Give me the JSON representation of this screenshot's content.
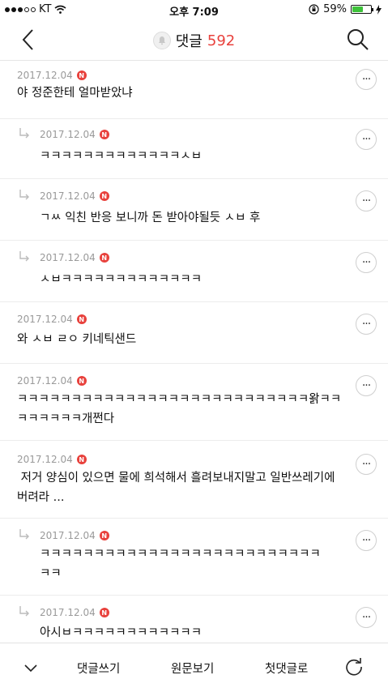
{
  "status_bar": {
    "carrier": "KT",
    "time": "오후 7:09",
    "battery": "59%",
    "battery_level": 0.59
  },
  "header": {
    "title": "댓글",
    "count": "592"
  },
  "comments": [
    {
      "date": "2017.12.04",
      "badge": "N",
      "text": "야 정준한테 얼마받았냐",
      "reply": false
    },
    {
      "date": "2017.12.04",
      "badge": "N",
      "text": "ㅋㅋㅋㅋㅋㅋㅋㅋㅋㅋㅋㅋㅋㅅㅂ",
      "reply": true
    },
    {
      "date": "2017.12.04",
      "badge": "N",
      "text": "ㄱㅆ 익친 반응 보니까 돈 받아야될듯 ㅅㅂ 후",
      "reply": true
    },
    {
      "date": "2017.12.04",
      "badge": "N",
      "text": "ㅅㅂㅋㅋㅋㅋㅋㅋㅋㅋㅋㅋㅋㅋㅋ",
      "reply": true
    },
    {
      "date": "2017.12.04",
      "badge": "N",
      "text": "와 ㅅㅂ ㄹㅇ 키네틱샌드",
      "reply": false
    },
    {
      "date": "2017.12.04",
      "badge": "N",
      "text_line1": "ㅋㅋㅋㅋㅋㅋㅋㅋㅋㅋㅋㅋㅋㅋㅋㅋㅋㅋㅋㅋㅋㅋㅋㅋㅋㅋㅋ왉ㅋㅋ",
      "text_line2": "ㅋㅋㅋㅋㅋㅋ개쩐다",
      "reply": false
    },
    {
      "date": "2017.12.04",
      "badge": "N",
      "text_line1": " 저거 양심이 있으면 물에 희석해서 흘려보내지말고 일반쓰레기에",
      "text_line2": "버려라 ...",
      "reply": false
    },
    {
      "date": "2017.12.04",
      "badge": "N",
      "text_line1": "ㅋㅋㅋㅋㅋㅋㅋㅋㅋㅋㅋㅋㅋㅋㅋㅋㅋㅋㅋㅋㅋㅋㅋㅋㅋㅋ",
      "text_line2": "ㅋㅋ",
      "reply": true
    },
    {
      "date": "2017.12.04",
      "badge": "N",
      "text": "아시ㅂㅋㅋㅋㅋㅋㅋㅋㅋㅋㅋㅋㅋ",
      "reply": true
    }
  ],
  "more_label": "···",
  "bottom_bar": {
    "write_label": "댓글쓰기",
    "original_label": "원문보기",
    "first_label": "첫댓글로"
  },
  "colors": {
    "accent": "#e8413c",
    "battery_green": "#3ec23a"
  }
}
